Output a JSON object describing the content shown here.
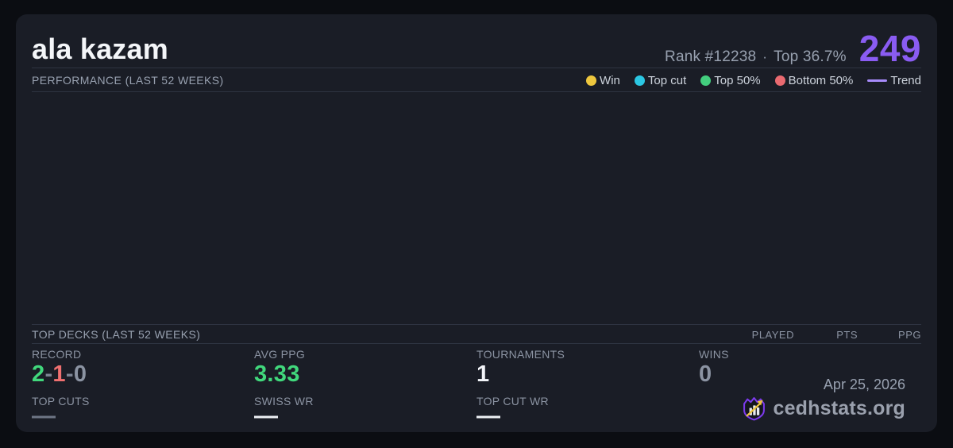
{
  "card": {
    "title": "ala kazam",
    "rank_text": "Rank #12238",
    "separator": "·",
    "top_percent_text": "Top 36.7%",
    "points": "249"
  },
  "performance": {
    "header": "PERFORMANCE (LAST 52 WEEKS)",
    "legend": [
      {
        "label": "Win",
        "color": "#eec73e",
        "type": "dot"
      },
      {
        "label": "Top cut",
        "color": "#2bc7e3",
        "type": "dot"
      },
      {
        "label": "Top 50%",
        "color": "#43ce7e",
        "type": "dot"
      },
      {
        "label": "Bottom 50%",
        "color": "#ea6a70",
        "type": "dot"
      },
      {
        "label": "Trend",
        "color": "#a78bfa",
        "type": "line"
      }
    ]
  },
  "top_decks": {
    "header": "TOP DECKS (LAST 52 WEEKS)",
    "columns": [
      "PLAYED",
      "PTS",
      "PPG"
    ],
    "rows": []
  },
  "stats": {
    "record": {
      "label": "RECORD",
      "wins": "2",
      "sep1": "-",
      "losses": "1",
      "sep2": "-",
      "draws": "0"
    },
    "avg_ppg": {
      "label": "AVG PPG",
      "value": "3.33"
    },
    "tournaments": {
      "label": "TOURNAMENTS",
      "value": "1"
    },
    "wins": {
      "label": "WINS",
      "value": "0"
    },
    "top_cuts": {
      "label": "TOP CUTS",
      "value": "—"
    },
    "swiss_wr": {
      "label": "SWISS WR",
      "value": "—"
    },
    "top_cut_wr": {
      "label": "TOP CUT WR",
      "value": "—"
    }
  },
  "footer": {
    "date": "Apr 25, 2026",
    "brand": "cedhstats.org"
  },
  "colors": {
    "page_background": "#0b0d12",
    "card_background": "#1a1d26",
    "divider": "#2e3442",
    "accent_purple": "#8a5cf2",
    "trend_purple": "#a78bfa",
    "win_yellow": "#eec73e",
    "top_cut_cyan": "#2bc7e3",
    "top50_green": "#43ce7e",
    "bottom50_red": "#ea6a70",
    "value_green": "#41d87c",
    "value_red": "#f07070",
    "value_gray": "#8b93a2",
    "value_white": "#f2f4f8",
    "logo_purple": "#7c3aed",
    "logo_gold": "#eec53d"
  }
}
